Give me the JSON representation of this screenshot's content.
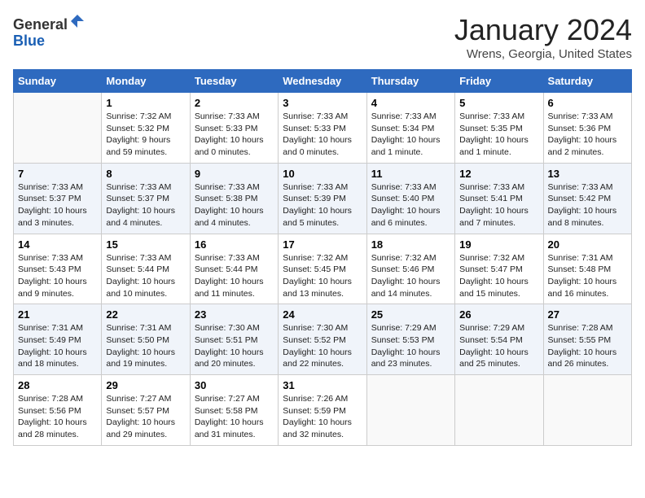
{
  "header": {
    "logo_line1": "General",
    "logo_line2": "Blue",
    "month_title": "January 2024",
    "location": "Wrens, Georgia, United States"
  },
  "days_of_week": [
    "Sunday",
    "Monday",
    "Tuesday",
    "Wednesday",
    "Thursday",
    "Friday",
    "Saturday"
  ],
  "weeks": [
    [
      {
        "num": "",
        "detail": ""
      },
      {
        "num": "1",
        "detail": "Sunrise: 7:32 AM\nSunset: 5:32 PM\nDaylight: 9 hours\nand 59 minutes."
      },
      {
        "num": "2",
        "detail": "Sunrise: 7:33 AM\nSunset: 5:33 PM\nDaylight: 10 hours\nand 0 minutes."
      },
      {
        "num": "3",
        "detail": "Sunrise: 7:33 AM\nSunset: 5:33 PM\nDaylight: 10 hours\nand 0 minutes."
      },
      {
        "num": "4",
        "detail": "Sunrise: 7:33 AM\nSunset: 5:34 PM\nDaylight: 10 hours\nand 1 minute."
      },
      {
        "num": "5",
        "detail": "Sunrise: 7:33 AM\nSunset: 5:35 PM\nDaylight: 10 hours\nand 1 minute."
      },
      {
        "num": "6",
        "detail": "Sunrise: 7:33 AM\nSunset: 5:36 PM\nDaylight: 10 hours\nand 2 minutes."
      }
    ],
    [
      {
        "num": "7",
        "detail": "Sunrise: 7:33 AM\nSunset: 5:37 PM\nDaylight: 10 hours\nand 3 minutes."
      },
      {
        "num": "8",
        "detail": "Sunrise: 7:33 AM\nSunset: 5:37 PM\nDaylight: 10 hours\nand 4 minutes."
      },
      {
        "num": "9",
        "detail": "Sunrise: 7:33 AM\nSunset: 5:38 PM\nDaylight: 10 hours\nand 4 minutes."
      },
      {
        "num": "10",
        "detail": "Sunrise: 7:33 AM\nSunset: 5:39 PM\nDaylight: 10 hours\nand 5 minutes."
      },
      {
        "num": "11",
        "detail": "Sunrise: 7:33 AM\nSunset: 5:40 PM\nDaylight: 10 hours\nand 6 minutes."
      },
      {
        "num": "12",
        "detail": "Sunrise: 7:33 AM\nSunset: 5:41 PM\nDaylight: 10 hours\nand 7 minutes."
      },
      {
        "num": "13",
        "detail": "Sunrise: 7:33 AM\nSunset: 5:42 PM\nDaylight: 10 hours\nand 8 minutes."
      }
    ],
    [
      {
        "num": "14",
        "detail": "Sunrise: 7:33 AM\nSunset: 5:43 PM\nDaylight: 10 hours\nand 9 minutes."
      },
      {
        "num": "15",
        "detail": "Sunrise: 7:33 AM\nSunset: 5:44 PM\nDaylight: 10 hours\nand 10 minutes."
      },
      {
        "num": "16",
        "detail": "Sunrise: 7:33 AM\nSunset: 5:44 PM\nDaylight: 10 hours\nand 11 minutes."
      },
      {
        "num": "17",
        "detail": "Sunrise: 7:32 AM\nSunset: 5:45 PM\nDaylight: 10 hours\nand 13 minutes."
      },
      {
        "num": "18",
        "detail": "Sunrise: 7:32 AM\nSunset: 5:46 PM\nDaylight: 10 hours\nand 14 minutes."
      },
      {
        "num": "19",
        "detail": "Sunrise: 7:32 AM\nSunset: 5:47 PM\nDaylight: 10 hours\nand 15 minutes."
      },
      {
        "num": "20",
        "detail": "Sunrise: 7:31 AM\nSunset: 5:48 PM\nDaylight: 10 hours\nand 16 minutes."
      }
    ],
    [
      {
        "num": "21",
        "detail": "Sunrise: 7:31 AM\nSunset: 5:49 PM\nDaylight: 10 hours\nand 18 minutes."
      },
      {
        "num": "22",
        "detail": "Sunrise: 7:31 AM\nSunset: 5:50 PM\nDaylight: 10 hours\nand 19 minutes."
      },
      {
        "num": "23",
        "detail": "Sunrise: 7:30 AM\nSunset: 5:51 PM\nDaylight: 10 hours\nand 20 minutes."
      },
      {
        "num": "24",
        "detail": "Sunrise: 7:30 AM\nSunset: 5:52 PM\nDaylight: 10 hours\nand 22 minutes."
      },
      {
        "num": "25",
        "detail": "Sunrise: 7:29 AM\nSunset: 5:53 PM\nDaylight: 10 hours\nand 23 minutes."
      },
      {
        "num": "26",
        "detail": "Sunrise: 7:29 AM\nSunset: 5:54 PM\nDaylight: 10 hours\nand 25 minutes."
      },
      {
        "num": "27",
        "detail": "Sunrise: 7:28 AM\nSunset: 5:55 PM\nDaylight: 10 hours\nand 26 minutes."
      }
    ],
    [
      {
        "num": "28",
        "detail": "Sunrise: 7:28 AM\nSunset: 5:56 PM\nDaylight: 10 hours\nand 28 minutes."
      },
      {
        "num": "29",
        "detail": "Sunrise: 7:27 AM\nSunset: 5:57 PM\nDaylight: 10 hours\nand 29 minutes."
      },
      {
        "num": "30",
        "detail": "Sunrise: 7:27 AM\nSunset: 5:58 PM\nDaylight: 10 hours\nand 31 minutes."
      },
      {
        "num": "31",
        "detail": "Sunrise: 7:26 AM\nSunset: 5:59 PM\nDaylight: 10 hours\nand 32 minutes."
      },
      {
        "num": "",
        "detail": ""
      },
      {
        "num": "",
        "detail": ""
      },
      {
        "num": "",
        "detail": ""
      }
    ]
  ]
}
